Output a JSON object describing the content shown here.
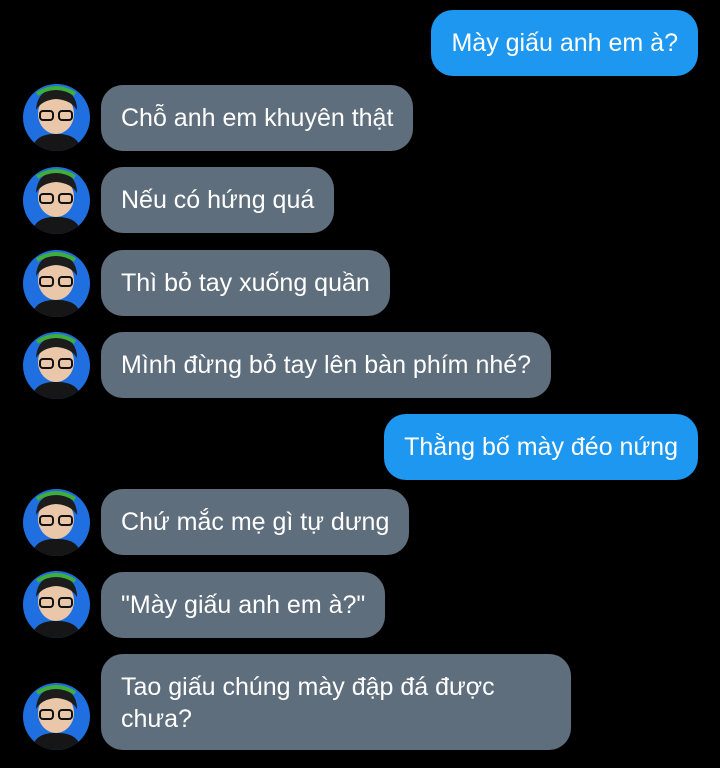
{
  "conversation": {
    "messages": [
      {
        "sender": "me",
        "text": "Mày giấu anh em à?"
      },
      {
        "sender": "other",
        "text": "Chỗ anh em khuyên thật"
      },
      {
        "sender": "other",
        "text": "Nếu có hứng quá"
      },
      {
        "sender": "other",
        "text": "Thì bỏ tay xuống quần"
      },
      {
        "sender": "other",
        "text": "Mình đừng bỏ tay lên bàn phím nhé?"
      },
      {
        "sender": "me",
        "text": "Thằng bố mày đéo nứng"
      },
      {
        "sender": "other",
        "text": "Chứ mắc mẹ gì tự dưng"
      },
      {
        "sender": "other",
        "text": "\"Mày giấu anh em à?\""
      },
      {
        "sender": "other",
        "text": "Tao giấu chúng mày đập đá được chưa?"
      }
    ]
  },
  "colors": {
    "background": "#000000",
    "outgoing_bubble": "#1d97f0",
    "incoming_bubble": "#5f6e7c",
    "avatar_background": "#1f6fe0",
    "text": "#ffffff"
  },
  "icons": {
    "avatar": "profile-photo-avatar"
  }
}
